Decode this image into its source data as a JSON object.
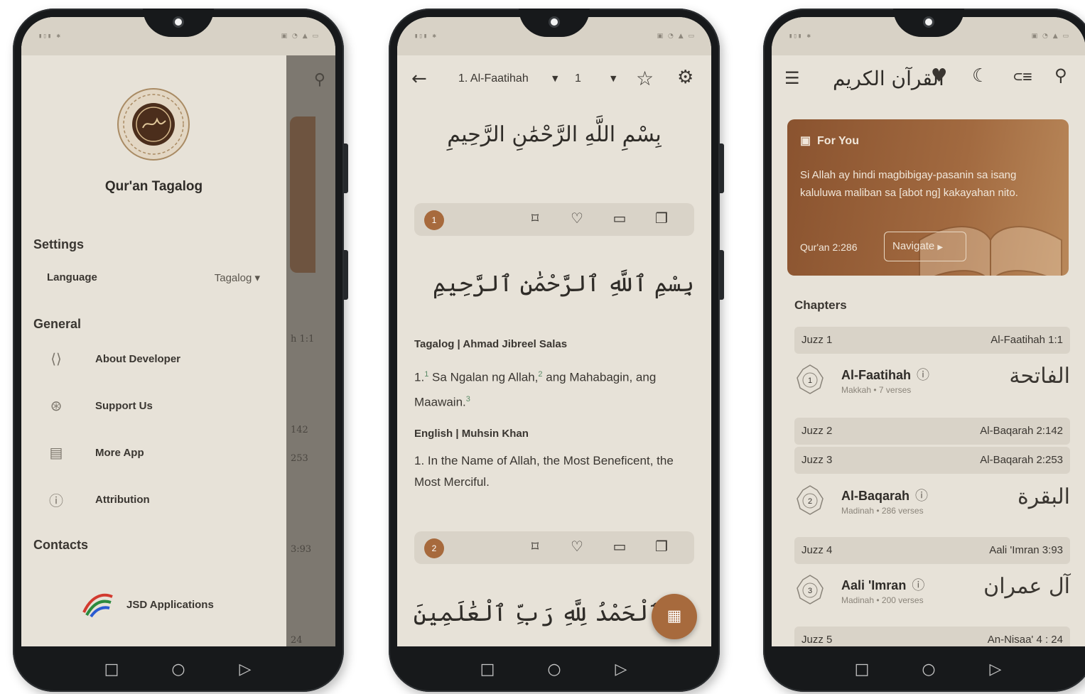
{
  "phone1": {
    "app_name": "Qur'an Tagalog",
    "settings_title": "Settings",
    "language_label": "Language",
    "language_value": "Tagalog",
    "general_title": "General",
    "menu": [
      {
        "label": "About Developer",
        "icon": "code-icon"
      },
      {
        "label": "Support Us",
        "icon": "support-icon"
      },
      {
        "label": "More App",
        "icon": "store-icon"
      },
      {
        "label": "Attribution",
        "icon": "attribution-icon"
      }
    ],
    "contacts_title": "Contacts",
    "brand": "JSD Applications",
    "behind_labels": [
      "h 1:1",
      "142",
      "253",
      "3:93",
      "24"
    ]
  },
  "phone2": {
    "chapter_select": "1. Al-Faatihah",
    "verse_select": "1",
    "bismillah_calligraphy": "بِسْمِ اللَّهِ الرَّحْمَٰنِ الرَّحِيمِ",
    "verse1": {
      "number": "1",
      "arabic": "بِسْمِ ٱللَّهِ ٱلرَّحْمَٰنِ ٱلرَّحِيمِ",
      "tagalog_head": "Tagalog | Ahmad Jibreel Salas",
      "tagalog_prefix": "1.",
      "tagalog_fn1": "1",
      "tagalog_part1": "Sa Ngalan ng Allah,",
      "tagalog_fn2": "2",
      "tagalog_part2": "ang Mahabagin, ang Maawain.",
      "tagalog_fn3": "3",
      "english_head": "English | Muhsin Khan",
      "english_text": "1. In the Name of Allah, the Most Beneficent, the Most Merciful."
    },
    "verse2": {
      "number": "2",
      "arabic": "ٱلْحَمْدُ لِلَّهِ رَبِّ ٱلْعَٰلَمِينَ"
    }
  },
  "phone3": {
    "title_calligraphy": "القرآن الكريم",
    "for_you_title": "For You",
    "for_you_text": "Si Allah ay hindi magbibigay-pasanin sa isang kaluluwa maliban sa [abot ng] kakayahan nito.",
    "for_you_ref": "Qur'an 2:286",
    "navigate_label": "Navigate",
    "chapters_title": "Chapters",
    "rows": [
      {
        "type": "juzz",
        "left": "Juzz 1",
        "right": "Al-Faatihah 1:1"
      },
      {
        "type": "chapter",
        "num": "1",
        "name": "Al-Faatihah",
        "meta": "Makkah  •  7 verses",
        "arabic": "الفاتحة"
      },
      {
        "type": "juzz",
        "left": "Juzz 2",
        "right": "Al-Baqarah 2:142"
      },
      {
        "type": "juzz",
        "left": "Juzz 3",
        "right": "Al-Baqarah 2:253"
      },
      {
        "type": "chapter",
        "num": "2",
        "name": "Al-Baqarah",
        "meta": "Madinah  •  286 verses",
        "arabic": "البقرة"
      },
      {
        "type": "juzz",
        "left": "Juzz 4",
        "right": "Aali 'Imran 3:93"
      },
      {
        "type": "chapter",
        "num": "3",
        "name": "Aali 'Imran",
        "meta": "Madinah  •  200 verses",
        "arabic": "آل عمران"
      },
      {
        "type": "juzz",
        "left": "Juzz 5",
        "right": "An-Nisaa' 4 : 24"
      }
    ]
  },
  "colors": {
    "background": "#e7e2d8",
    "accent": "#a76a3d",
    "text": "#3a3631",
    "bar": "#d9d3c8"
  }
}
